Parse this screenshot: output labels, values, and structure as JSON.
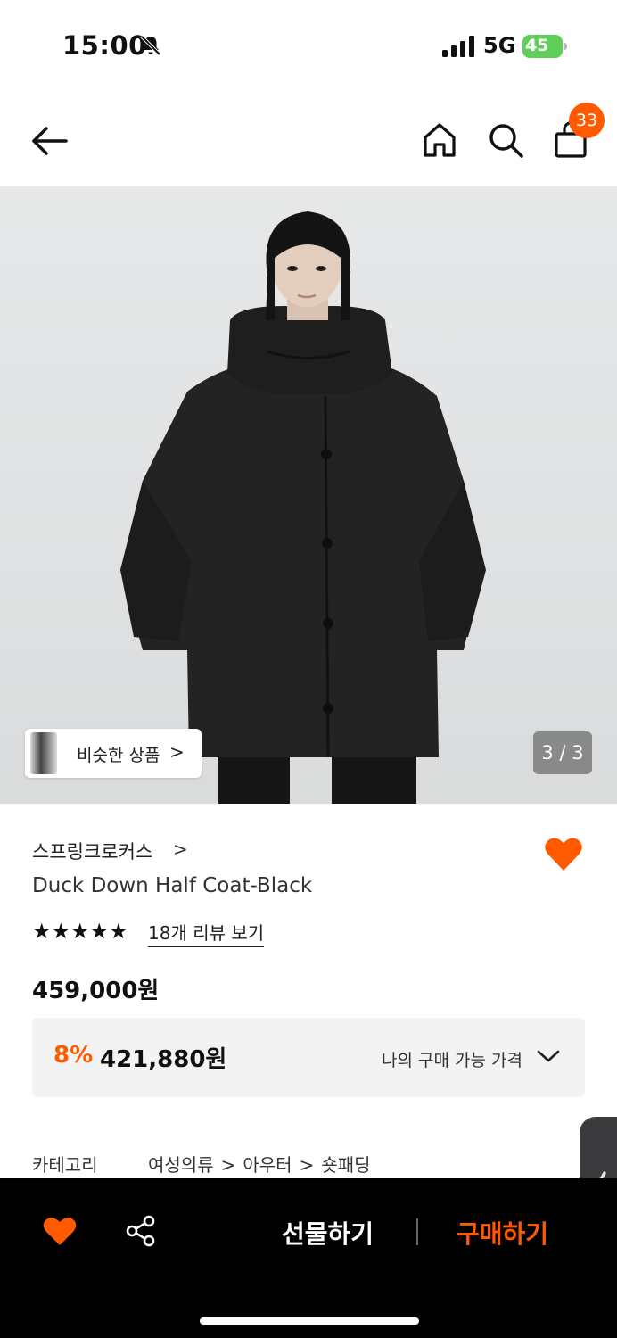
{
  "status_bar": {
    "time": "15:00",
    "network": "5G",
    "battery": "45"
  },
  "nav": {
    "cart_count": "33"
  },
  "hero": {
    "similar_label": "비슷한 상품",
    "similar_chevron": ">",
    "page_indicator": "3 / 3"
  },
  "product": {
    "brand": "스프링크로커스",
    "brand_chevron": ">",
    "title": "Duck Down Half Coat-Black",
    "stars": "★★★★★",
    "rating": 5,
    "reviews_link": "18개 리뷰 보기",
    "price": "459,000원",
    "discount_rate": "8%",
    "discount_price": "421,880원",
    "my_price_label": "나의 구매 가능 가격"
  },
  "category": {
    "label": "카테고리",
    "path": [
      "여성의류",
      "아우터",
      "숏패딩"
    ],
    "separator": ">"
  },
  "bottom_bar": {
    "gift_label": "선물하기",
    "buy_label": "구매하기"
  },
  "colors": {
    "accent": "#ff5a00",
    "bottom_bar_bg": "#000000",
    "battery": "#5fcf5a"
  },
  "icons": [
    "bell-slash-icon",
    "signal-icon",
    "battery-icon",
    "back-arrow-icon",
    "home-icon",
    "search-icon",
    "shopping-bag-icon",
    "heart-icon",
    "share-icon",
    "chevron-down-icon",
    "chevron-left-icon"
  ]
}
